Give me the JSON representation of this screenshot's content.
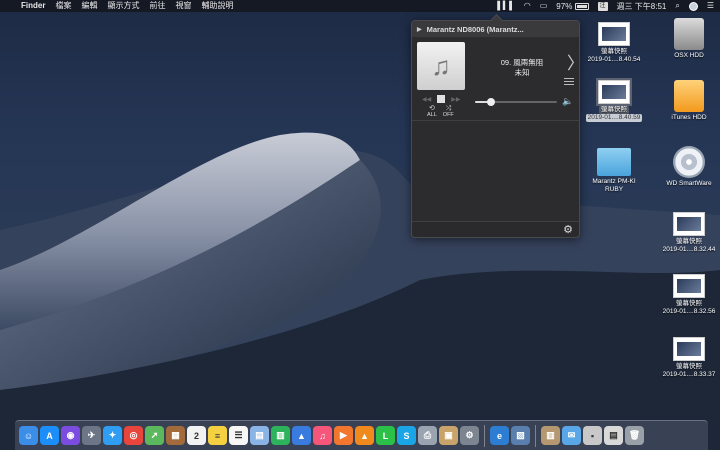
{
  "menubar": {
    "apple": "",
    "items": [
      "Finder",
      "檔案",
      "編輯",
      "顯示方式",
      "前往",
      "視窗",
      "輔助說明"
    ],
    "battery": "97%",
    "ime": "注",
    "clock": "週三 下午8:51"
  },
  "player": {
    "device": "Marantz ND8006 (Marantz...",
    "track_title": "09. 風兩無阻",
    "track_artist": "未知",
    "repeat_label": "ALL",
    "shuffle_label": "OFF",
    "volume_level": 0.2
  },
  "desktop": {
    "icons": [
      {
        "label": "螢幕快照",
        "sub": "2019-01....8.40.54"
      },
      {
        "label": "OSX HDD",
        "sub": ""
      },
      {
        "label": "螢幕快照",
        "sub": "2019-01....8.40.59"
      },
      {
        "label": "iTunes HDD",
        "sub": ""
      },
      {
        "label": "Marantz PM-KI",
        "sub": "RUBY"
      },
      {
        "label": "WD SmartWare",
        "sub": ""
      },
      {
        "label": "螢幕快照",
        "sub": "2019-01....8.32.44"
      },
      {
        "label": "螢幕快照",
        "sub": "2019-01....8.32.56"
      },
      {
        "label": "螢幕快照",
        "sub": "2019-01....8.33.37"
      }
    ]
  },
  "dock": {
    "apps": [
      {
        "name": "finder-app-icon",
        "color": "#3b8ee8",
        "glyph": "☺"
      },
      {
        "name": "app-store-app-icon",
        "color": "#1c8ef9",
        "glyph": "A"
      },
      {
        "name": "siri-app-icon",
        "color": "#7a4de0",
        "glyph": "◉"
      },
      {
        "name": "launchpad-app-icon",
        "color": "#6c7686",
        "glyph": "✈"
      },
      {
        "name": "safari-app-icon",
        "color": "#2f9df2",
        "glyph": "✦"
      },
      {
        "name": "chrome-app-icon",
        "color": "#e8453c",
        "glyph": "◎"
      },
      {
        "name": "maps-app-icon",
        "color": "#5cb85c",
        "glyph": "➚"
      },
      {
        "name": "notebook-app-icon",
        "color": "#a36a3c",
        "glyph": "▦"
      },
      {
        "name": "calendar-app-icon",
        "color": "#f2f2f2",
        "glyph": "2"
      },
      {
        "name": "notes-app-icon",
        "color": "#f5d142",
        "glyph": "≡"
      },
      {
        "name": "reminders-app-icon",
        "color": "#f7f7f7",
        "glyph": "☰"
      },
      {
        "name": "preview-app-icon",
        "color": "#8bb4e6",
        "glyph": "▤"
      },
      {
        "name": "numbers-app-icon",
        "color": "#2db35b",
        "glyph": "▥"
      },
      {
        "name": "keynote-app-icon",
        "color": "#3a7be0",
        "glyph": "▲"
      },
      {
        "name": "itunes-app-icon",
        "color": "#f6567a",
        "glyph": "♫"
      },
      {
        "name": "player-app-icon",
        "color": "#f2762e",
        "glyph": "▶"
      },
      {
        "name": "vlc-app-icon",
        "color": "#f08a1c",
        "glyph": "▲"
      },
      {
        "name": "line-app-icon",
        "color": "#2bc148",
        "glyph": "L"
      },
      {
        "name": "skype-app-icon",
        "color": "#1aa5e6",
        "glyph": "S"
      },
      {
        "name": "scanner-app-icon",
        "color": "#9aa3b0",
        "glyph": "⎙"
      },
      {
        "name": "archive-app-icon",
        "color": "#c9a46a",
        "glyph": "▣"
      },
      {
        "name": "system-preferences-app-icon",
        "color": "#7d8591",
        "glyph": "⚙"
      },
      {
        "name": "edge-app-icon",
        "color": "#2d7dd2",
        "glyph": "e"
      },
      {
        "name": "image-capture-app-icon",
        "color": "#5a7fae",
        "glyph": "▧"
      },
      {
        "name": "downloads-stack-icon",
        "color": "#b59872",
        "glyph": "▥"
      },
      {
        "name": "mail-app-icon",
        "color": "#5aa7e8",
        "glyph": "✉"
      },
      {
        "name": "screenshot-stack-icon",
        "color": "#c8c8c8",
        "glyph": "▪"
      },
      {
        "name": "documents-stack-icon",
        "color": "#d9d9d9",
        "glyph": "▤"
      },
      {
        "name": "trash-icon",
        "color": "#9aa0a8",
        "glyph": "🗑"
      }
    ]
  }
}
